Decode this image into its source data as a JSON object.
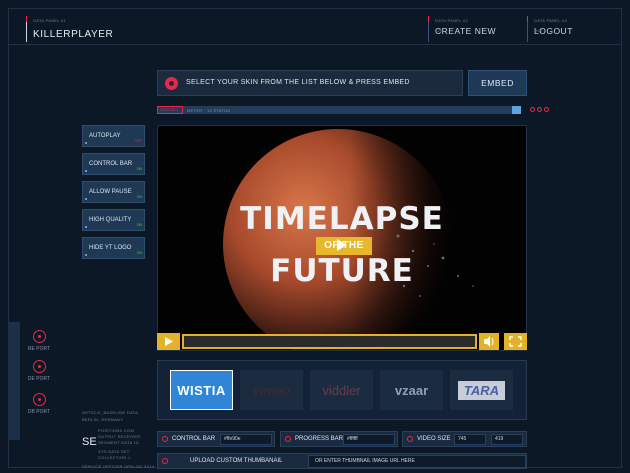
{
  "header": {
    "brand_tiny": "DATA PANEL #1",
    "brand": "KILLERPLAYER",
    "create_tiny": "DATA PANEL #2",
    "create": "CREATE NEW",
    "create_code": "CRE",
    "logout_tiny": "DATA PANEL #3",
    "logout": "LOGOUT",
    "logout_code": "OUT"
  },
  "select_bar": {
    "text": "SELECT YOUR SKIN FROM THE  LIST BELOW & PRESS EMBED",
    "embed": "EMBED"
  },
  "progress": {
    "tag": "STATUS 1",
    "meta": "METER · 12 STATUS",
    "value": 1.0
  },
  "options": [
    {
      "label": "AUTOPLAY",
      "state": "OFF",
      "on": false
    },
    {
      "label": "CONTROL BAR",
      "state": "ON",
      "on": true
    },
    {
      "label": "ALLOW PAUSE",
      "state": "ON",
      "on": true
    },
    {
      "label": "HIGH QUALITY",
      "state": "ON",
      "on": true
    },
    {
      "label": "HIDE YT LOGO",
      "state": "ON",
      "on": true
    }
  ],
  "ports": [
    "RE PORT",
    "DE PORT",
    "DB PORT"
  ],
  "meta": {
    "header": "ARTICLE_BASELINE DATA",
    "line2": "BERLIN, GERMANY",
    "se": "SE",
    "coords": [
      "POSITIONS.COM",
      "OUTPUT RECEIVER",
      "SEGMENT DATA 16"
    ],
    "sys1": "SYS DATA SET",
    "sys2": "COLLECTION 1",
    "sys3": "SERVICE OFFICER UPDLOD 0X14"
  },
  "video": {
    "title_top": "TIMELAPSE",
    "title_mid": "OF THE",
    "title_bottom": "FUTURE"
  },
  "skins": [
    "WISTIA",
    "vimeo",
    "viddler",
    "vzaar",
    "TARA"
  ],
  "settings": {
    "control_bar_label": "CONTROL BAR",
    "control_bar_value": "#ffe90e",
    "progress_bar_label": "PROGRESS BAR",
    "progress_bar_value": "#ffffff",
    "video_size_label": "VIDEO SIZE",
    "video_width": "745",
    "video_height": "419"
  },
  "upload": {
    "label": "UPLOAD CUSTOM THUMBANAIL",
    "placeholder": "OR ENTER THUMBNAIL IMAGE URL HERE"
  },
  "colors": {
    "accent_red": "#e8284a",
    "player_yellow": "#e2b22a",
    "panel_blue": "#1f3955"
  }
}
